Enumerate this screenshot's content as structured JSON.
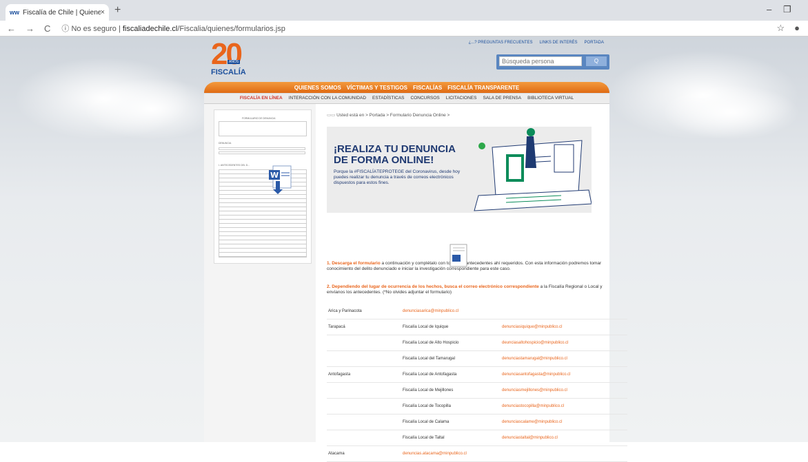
{
  "browser": {
    "tab_title": "Fiscalía de Chile | Quienes Somos",
    "tab_close": "×",
    "new_tab": "+",
    "security": "No es seguro",
    "url_host": "fiscaliadechile.cl",
    "url_path": "/Fiscalia/quienes/formularios.jsp",
    "win_min": "–",
    "win_max": "❐"
  },
  "header": {
    "logo_number": "20",
    "logo_years": "AÑOS",
    "logo_text": "FISCALÍA",
    "top_links": [
      "¿...? PREGUNTAS FRECUENTES",
      "LINKS DE INTERÉS",
      "PORTADA"
    ],
    "search_placeholder": "Búsqueda persona",
    "search_button": "Q"
  },
  "main_nav": [
    "QUIENES SOMOS",
    "VÍCTIMAS Y TESTIGOS",
    "FISCALÍAS",
    "FISCALÍA TRANSPARENTE"
  ],
  "sub_nav": [
    "FISCALÍA EN LÍNEA",
    "INTERACCIÓN CON LA COMUNIDAD",
    "ESTADÍSTICAS",
    "CONCURSOS",
    "LICITACIONES",
    "SALA DE PRENSA",
    "BIBLIOTECA VIRTUAL"
  ],
  "left": {
    "form_title": "FORMULARIO DE DENUNCIA",
    "section_denuncia": "DENUNCIA",
    "section_antecedentes": "I. ANTECEDENTES DEL D..."
  },
  "breadcrumb": "Usted está en > Portada > Formulario Denuncia Online >",
  "banner": {
    "heading_line1": "¡REALIZA TU DENUNCIA",
    "heading_line2": "DE FORMA ONLINE!",
    "text": "Porque la #FISCALÍAТEPROTEGE del Coronavirus, desde hoy puedes realizar tu denuncia a través de correos electrónicos dispuestos para estos fines."
  },
  "step1": {
    "highlight": "1. Descarga el formulario",
    "text": " a continuación y complétalo con todos los antecedentes ahí requeridos. Con esta información podremos tomar conocimiento del delito denunciado e iniciar la investigación correspondiente para este caso."
  },
  "step2": {
    "highlight": "2. Dependiendo del lugar de ocurrencia de los hechos, busca el correo electrónico correspondiente",
    "text": " a la Fiscalía Regional o Local y envíanos los antecedentes. (*No olvides adjuntar el formulario)"
  },
  "directory": [
    {
      "region": "Arica y Parinacota",
      "office": "",
      "email": "denunciasarica@minpublico.cl",
      "email_col": 1
    },
    {
      "region": "Tarapacá",
      "office": "Fiscalía Local de Iquique",
      "email": "denunciasiquique@minpublico.cl",
      "email_col": 2
    },
    {
      "region": "",
      "office": "Fiscalía Local de Alto Hospicio",
      "email": "deunciasaltohospicio@minpublico.cl",
      "email_col": 2
    },
    {
      "region": "",
      "office": "Fiscalía Local del Tamarugal",
      "email": "denunciastamarugal@minpublico.cl",
      "email_col": 2
    },
    {
      "region": "Antofagasta",
      "office": "Fiscalía Local de Antofagasta",
      "email": "denunciasantofagasta@minpublico.cl",
      "email_col": 2
    },
    {
      "region": "",
      "office": "Fiscalía Local de Mejillones",
      "email": "denunciasmejillones@minpublico.cl",
      "email_col": 2
    },
    {
      "region": "",
      "office": "Fiscalía Local de Tocopilla",
      "email": "denunciastocopilla@minpublico.cl",
      "email_col": 2
    },
    {
      "region": "",
      "office": "Fiscalía Local de Calama",
      "email": "denunciascalame@minpublico.cl",
      "email_col": 2
    },
    {
      "region": "",
      "office": "Fiscalía Local de Taltal",
      "email": "denunciastaltal@minpublico.cl",
      "email_col": 2
    },
    {
      "region": "Atacama",
      "office": "",
      "email": "denuncias.atacama@minpublico.cl",
      "email_col": 1
    }
  ]
}
